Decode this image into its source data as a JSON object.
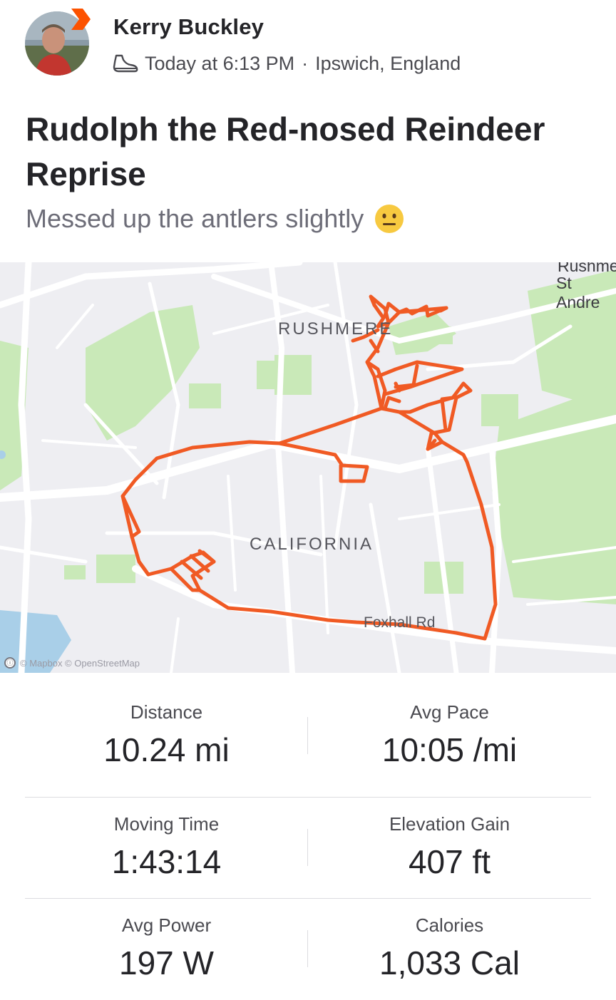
{
  "athlete": {
    "name": "Kerry Buckley",
    "time": "Today at 6:13 PM",
    "separator": "·",
    "location": "Ipswich, England"
  },
  "activity": {
    "title": "Rudolph the Red-nosed Reindeer Reprise",
    "description": "Messed up the antlers slightly"
  },
  "map": {
    "labels": {
      "rushmere": "RUSHMERE",
      "california": "CALIFORNIA",
      "foxhall": "Foxhall Rd",
      "rushmere_corner": "Rushmere",
      "st_andrews": "St Andre"
    },
    "attribution": "© Mapbox © OpenStreetMap",
    "attribution_icon": "ⓘ",
    "route_color": "#f05a24",
    "park_color": "#c9e9b8"
  },
  "stats": [
    {
      "label": "Distance",
      "value": "10.24 mi"
    },
    {
      "label": "Avg Pace",
      "value": "10:05 /mi"
    },
    {
      "label": "Moving Time",
      "value": "1:43:14"
    },
    {
      "label": "Elevation Gain",
      "value": "407 ft"
    },
    {
      "label": "Avg Power",
      "value": "197 W"
    },
    {
      "label": "Calories",
      "value": "1,033 Cal"
    }
  ],
  "icons": {
    "brand": "strava-chevron-icon",
    "activity_type": "shoe-icon",
    "emoji": "neutral-face-emoji"
  },
  "colors": {
    "brand": "#fc5200",
    "text_primary": "#242428",
    "text_secondary": "#6d6d78"
  }
}
